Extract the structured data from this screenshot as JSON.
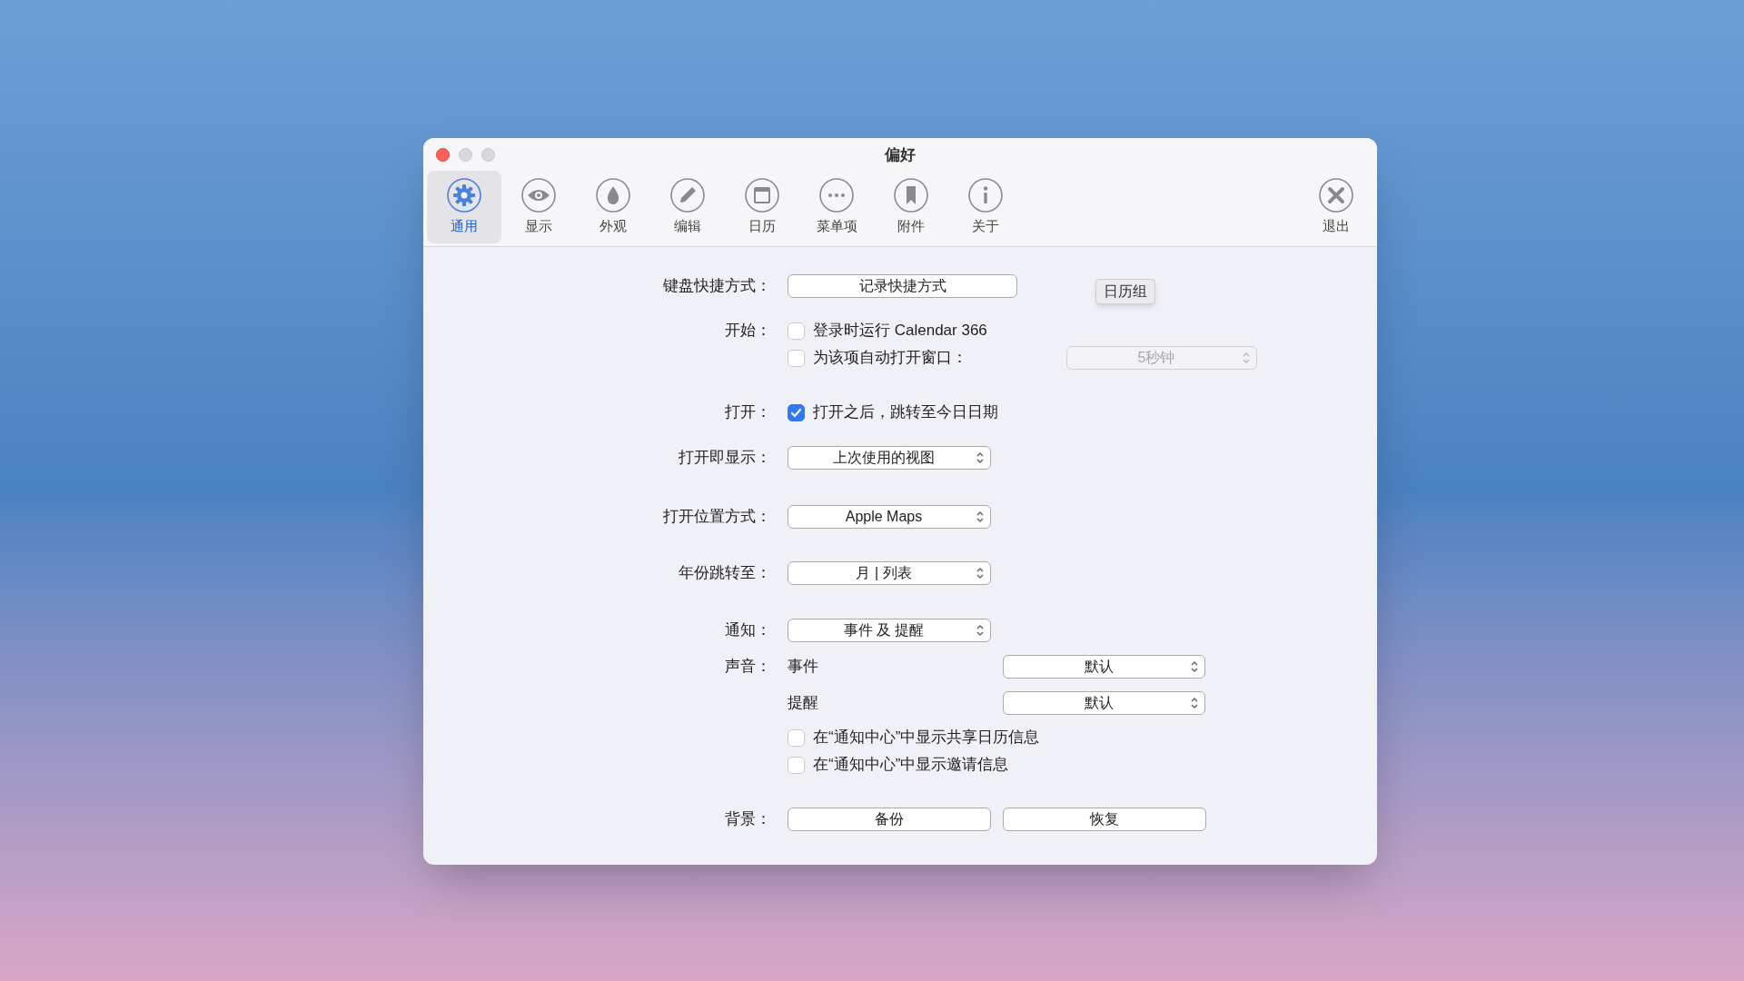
{
  "window": {
    "title": "偏好"
  },
  "toolbar": {
    "items": [
      {
        "label": "通用",
        "selected": true
      },
      {
        "label": "显示",
        "selected": false
      },
      {
        "label": "外观",
        "selected": false
      },
      {
        "label": "编辑",
        "selected": false
      },
      {
        "label": "日历",
        "selected": false
      },
      {
        "label": "菜单项",
        "selected": false
      },
      {
        "label": "附件",
        "selected": false
      },
      {
        "label": "关于",
        "selected": false
      }
    ],
    "quit": {
      "label": "退出"
    }
  },
  "rows": [
    {
      "kind": "button",
      "label": "键盘快捷方式：",
      "button": "记录快捷方式",
      "side_button": "日历组"
    },
    {
      "kind": "checks",
      "label": "开始：",
      "items": [
        {
          "text": "登录时运行 Calendar 366",
          "checked": false
        },
        {
          "text": "为该项自动打开窗口：",
          "checked": false,
          "popup": {
            "value": "5秒钟",
            "disabled": true
          }
        }
      ]
    },
    {
      "kind": "checks",
      "label": "打开：",
      "items": [
        {
          "text": "打开之后，跳转至今日日期",
          "checked": true
        }
      ]
    },
    {
      "kind": "popup",
      "label": "打开即显示：",
      "value": "上次使用的视图"
    },
    {
      "kind": "popup",
      "label": "打开位置方式：",
      "value": "Apple Maps"
    },
    {
      "kind": "popup",
      "label": "年份跳转至：",
      "value": "月 | 列表"
    },
    {
      "kind": "popup",
      "label": "通知：",
      "value": "事件 及 提醒"
    },
    {
      "kind": "sound",
      "label": "声音：",
      "items": [
        {
          "name": "事件",
          "value": "默认"
        },
        {
          "name": "提醒",
          "value": "默认"
        }
      ]
    },
    {
      "kind": "checks",
      "items": [
        {
          "text": "在“通知中心”中显示共享日历信息",
          "checked": false
        },
        {
          "text": "在“通知中心”中显示邀请信息",
          "checked": false
        }
      ]
    },
    {
      "kind": "buttons",
      "label": "背景：",
      "buttons": [
        "备份",
        "恢复"
      ]
    }
  ]
}
